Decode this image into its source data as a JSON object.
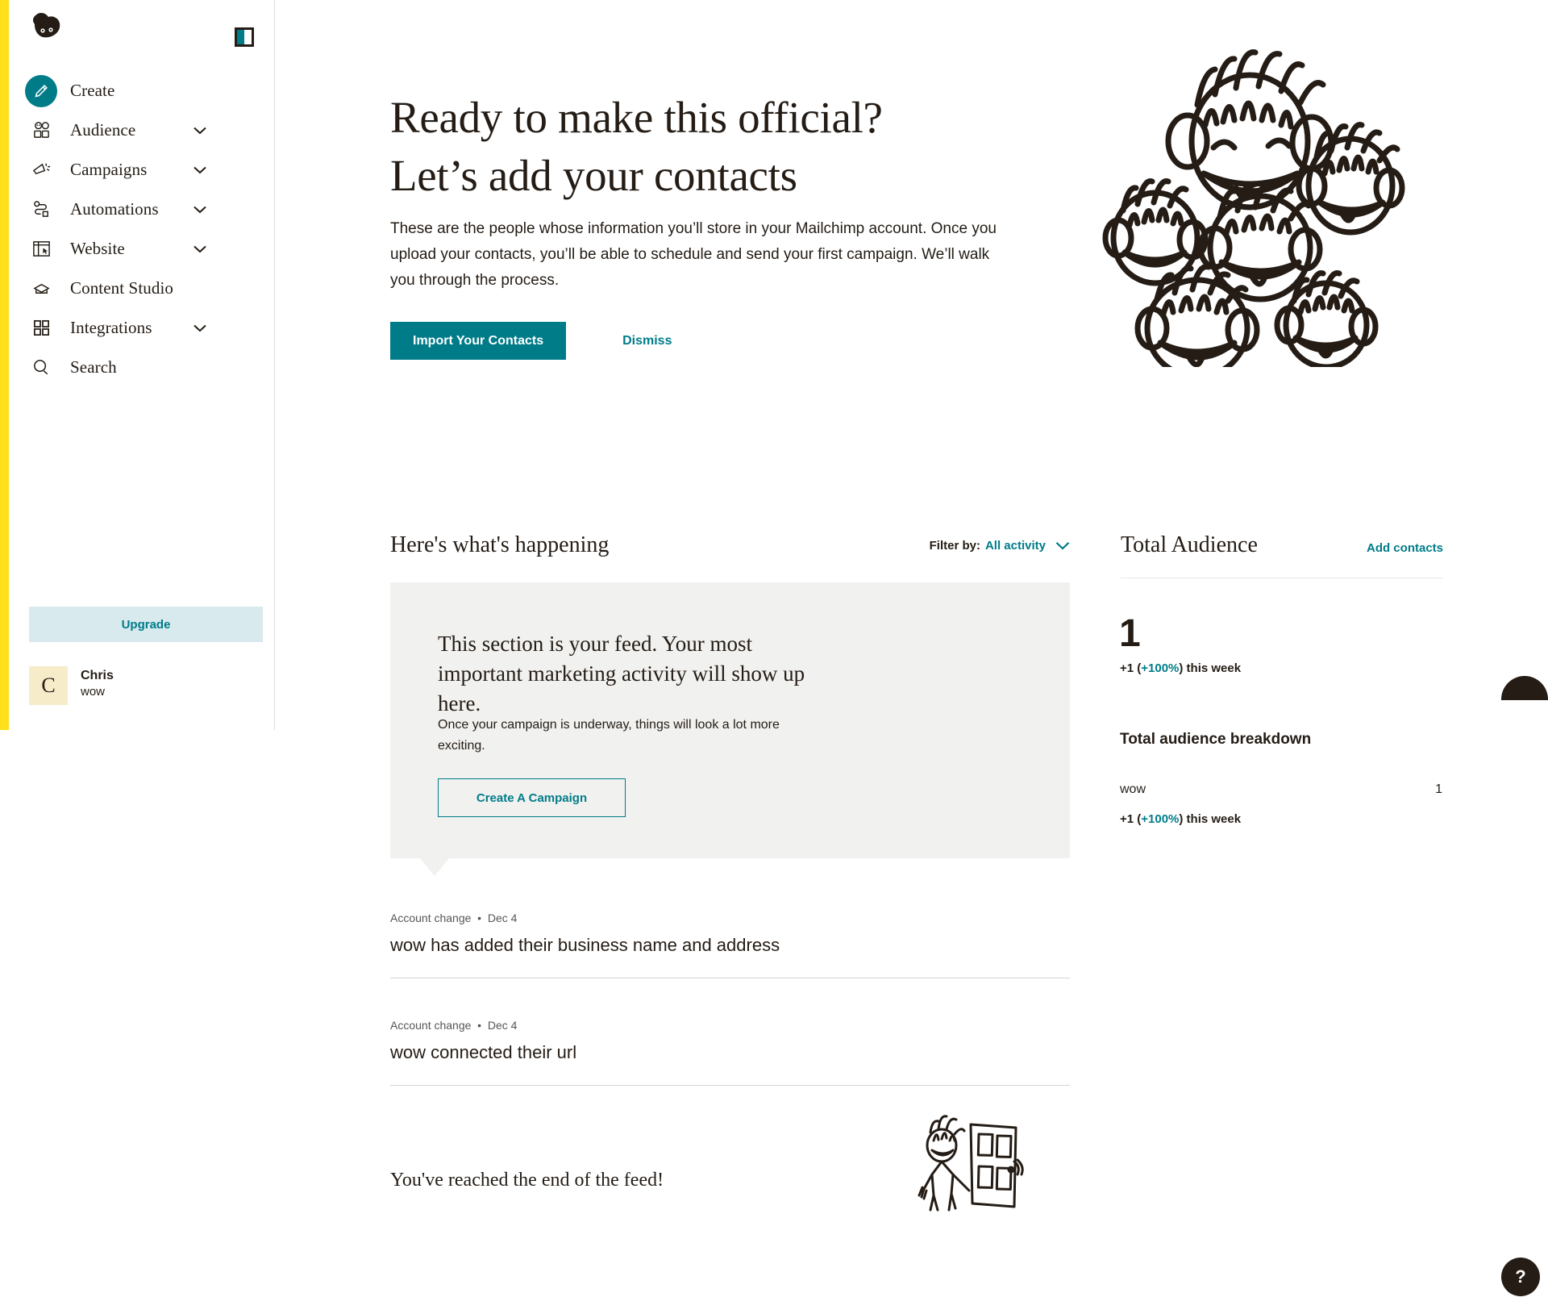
{
  "brand": {
    "logo_icon": "mailchimp-freddie-logo",
    "panel_toggle_icon": "sidebar-toggle-icon"
  },
  "sidebar": {
    "items": [
      {
        "label": "Create",
        "icon": "pencil-icon",
        "has_caret": false,
        "active": true
      },
      {
        "label": "Audience",
        "icon": "people-icon",
        "has_caret": true,
        "active": false
      },
      {
        "label": "Campaigns",
        "icon": "megaphone-icon",
        "has_caret": true,
        "active": false
      },
      {
        "label": "Automations",
        "icon": "automation-flow-icon",
        "has_caret": true,
        "active": false
      },
      {
        "label": "Website",
        "icon": "browser-window-icon",
        "has_caret": true,
        "active": false
      },
      {
        "label": "Content Studio",
        "icon": "content-studio-icon",
        "has_caret": false,
        "active": false
      },
      {
        "label": "Integrations",
        "icon": "grid-squares-icon",
        "has_caret": true,
        "active": false
      },
      {
        "label": "Search",
        "icon": "search-icon",
        "has_caret": false,
        "active": false
      }
    ],
    "upgrade_label": "Upgrade",
    "user": {
      "initial": "C",
      "name": "Chris",
      "org": "wow"
    }
  },
  "hero": {
    "title_line1": "Ready to make this official?",
    "title_line2": "Let’s add your contacts",
    "body": "These are the people whose information you’ll store in your Mailchimp account. Once you upload your contacts, you’ll be able to schedule and send your first campaign. We’ll walk you through the process.",
    "primary_label": "Import Your Contacts",
    "dismiss_label": "Dismiss",
    "illustration_icon": "group-of-people-illustration"
  },
  "feed": {
    "title": "Here's what's happening",
    "filter_label": "Filter by:",
    "filter_value": "All activity",
    "filter_caret_icon": "chevron-down-icon",
    "card": {
      "heading": "This section is your feed. Your most important marketing activity will show up here.",
      "body": "Once your campaign is underway, things will look a lot more exciting.",
      "cta_label": "Create A Campaign"
    },
    "items": [
      {
        "type": "Account change",
        "date": "Dec 4",
        "text": "wow has added their business name and address"
      },
      {
        "type": "Account change",
        "date": "Dec 4",
        "text": "wow connected their url"
      }
    ],
    "end_text": "You've reached the end of the feed!",
    "end_illustration_icon": "person-with-door-illustration"
  },
  "audience": {
    "title": "Total Audience",
    "add_label": "Add contacts",
    "count": "1",
    "delta_prefix": "+1 (",
    "delta_pct": "+100%",
    "delta_suffix": ") this week",
    "breakdown_title": "Total audience breakdown",
    "rows": [
      {
        "name": "wow",
        "value": "1",
        "delta_prefix": "+1 (",
        "delta_pct": "+100%",
        "delta_suffix": ") this week"
      }
    ]
  },
  "floaters": {
    "help_label": "?",
    "side_tab_icon": "drawer-handle-icon"
  },
  "colors": {
    "teal": "#007c89",
    "yellow": "#ffe01b",
    "ink": "#241c15",
    "card_bg": "#f1f1ef",
    "upgrade_bg": "#d8eaee"
  }
}
